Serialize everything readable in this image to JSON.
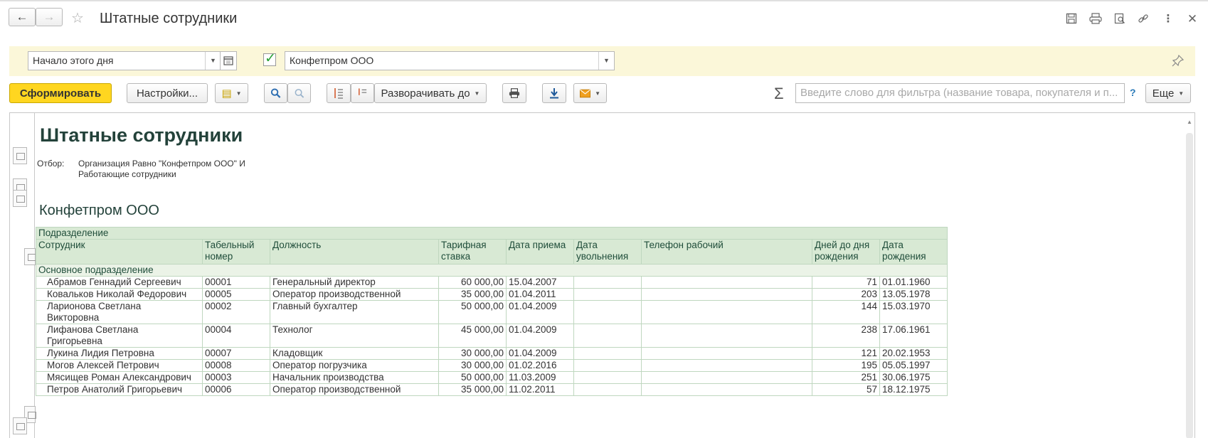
{
  "header": {
    "title": "Штатные сотрудники",
    "back_icon": "arrow-left-icon",
    "forward_icon": "arrow-right-icon",
    "favorite_icon": "star-icon"
  },
  "filters": {
    "period": "Начало этого дня",
    "organization_checked": true,
    "organization": "Конфетпром ООО"
  },
  "toolbar": {
    "generate": "Сформировать",
    "settings": "Настройки...",
    "expand_to": "Разворачивать до",
    "search_placeholder": "Введите слово для фильтра (название товара, покупателя и п...",
    "help": "?",
    "more": "Еще",
    "sigma": "Σ"
  },
  "report": {
    "title": "Штатные сотрудники",
    "selection_label": "Отбор:",
    "selection_line1": "Организация Равно \"Конфетпром ООО\" И",
    "selection_line2": "Работающие сотрудники",
    "organization": "Конфетпром ООО",
    "group_header": "Подразделение",
    "columns": {
      "employee": "Сотрудник",
      "tab_num_1": "Табельный",
      "tab_num_2": "номер",
      "position": "Должность",
      "rate_1": "Тарифная",
      "rate_2": "ставка",
      "hire_date": "Дата приема",
      "dismissal_1": "Дата",
      "dismissal_2": "увольнения",
      "phone": "Телефон рабочий",
      "days_1": "Дней до дня",
      "days_2": "рождения",
      "birth_1": "Дата",
      "birth_2": "рождения"
    },
    "department": "Основное подразделение",
    "rows": [
      {
        "name_1": "Абрамов Геннадий Сергеевич",
        "name_2": "",
        "tab": "00001",
        "position": "Генеральный директор",
        "rate": "60 000,00",
        "hire": "15.04.2007",
        "dismissal": "",
        "phone": "",
        "days": "71",
        "birth": "01.01.1960"
      },
      {
        "name_1": "Ковальков Николай Федорович",
        "name_2": "",
        "tab": "00005",
        "position": "Оператор производственной",
        "rate": "35 000,00",
        "hire": "01.04.2011",
        "dismissal": "",
        "phone": "",
        "days": "203",
        "birth": "13.05.1978"
      },
      {
        "name_1": "Ларионова Светлана",
        "name_2": "Викторовна",
        "tab": "00002",
        "position": "Главный бухгалтер",
        "rate": "50 000,00",
        "hire": "01.04.2009",
        "dismissal": "",
        "phone": "",
        "days": "144",
        "birth": "15.03.1970"
      },
      {
        "name_1": "Лифанова Светлана",
        "name_2": "Григорьевна",
        "tab": "00004",
        "position": "Технолог",
        "rate": "45 000,00",
        "hire": "01.04.2009",
        "dismissal": "",
        "phone": "",
        "days": "238",
        "birth": "17.06.1961"
      },
      {
        "name_1": "Лукина Лидия Петровна",
        "name_2": "",
        "tab": "00007",
        "position": "Кладовщик",
        "rate": "30 000,00",
        "hire": "01.04.2009",
        "dismissal": "",
        "phone": "",
        "days": "121",
        "birth": "20.02.1953"
      },
      {
        "name_1": "Могов Алексей Петрович",
        "name_2": "",
        "tab": "00008",
        "position": "Оператор погрузчика",
        "rate": "30 000,00",
        "hire": "01.02.2016",
        "dismissal": "",
        "phone": "",
        "days": "195",
        "birth": "05.05.1997"
      },
      {
        "name_1": "Мясищев Роман Александрович",
        "name_2": "",
        "tab": "00003",
        "position": "Начальник производства",
        "rate": "50 000,00",
        "hire": "11.03.2009",
        "dismissal": "",
        "phone": "",
        "days": "251",
        "birth": "30.06.1975"
      },
      {
        "name_1": "Петров Анатолий Григорьевич",
        "name_2": "",
        "tab": "00006",
        "position": "Оператор производственной",
        "rate": "35 000,00",
        "hire": "11.02.2011",
        "dismissal": "",
        "phone": "",
        "days": "57",
        "birth": "18.12.1975"
      }
    ]
  },
  "colors": {
    "accent_button": "#ffd620",
    "filter_bar": "#fbf7d9",
    "table_header": "#d8e9d4",
    "title_text": "#23423a"
  }
}
